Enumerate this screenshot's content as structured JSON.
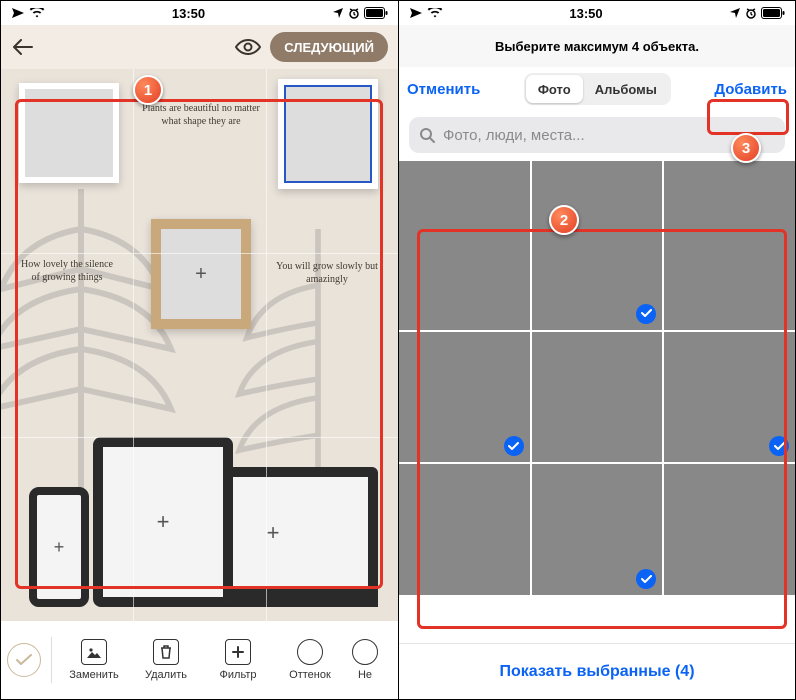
{
  "status": {
    "time": "13:50"
  },
  "left": {
    "next_label": "СЛЕДУЮЩИЙ",
    "quote1": "Plants are beautiful no matter what shape they are",
    "quote2": "How lovely the silence of growing things",
    "quote3": "You will grow slowly but amazingly",
    "toolbar": {
      "replace": "Заменить",
      "delete": "Удалить",
      "filter": "Фильтр",
      "tint": "Оттенок",
      "more": "Не"
    }
  },
  "right": {
    "subtitle": "Выберите максимум 4 объекта.",
    "cancel": "Отменить",
    "seg_photo": "Фото",
    "seg_albums": "Альбомы",
    "add": "Добавить",
    "search_placeholder": "Фото, люди, места...",
    "show_selected": "Показать выбранные (4)"
  },
  "callouts": {
    "a": "1",
    "b": "2",
    "c": "3"
  }
}
